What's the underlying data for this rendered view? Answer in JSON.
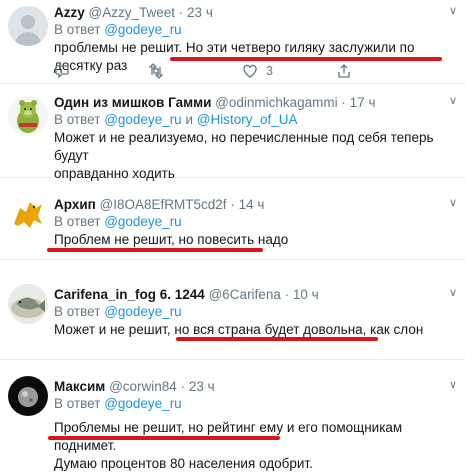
{
  "tweets": [
    {
      "name": "Azzy",
      "handle": "@Azzy_Tweet",
      "dot": "·",
      "time": "23 ч",
      "reply_prefix": "В ответ",
      "reply_to": "@godeye_ru",
      "reply_to_2": "",
      "text_lines": [
        "проблемы не решит. Но эти четверо гиляку заслужили по десятку раз"
      ],
      "likes": "3",
      "avatar": "gray-placeholder"
    },
    {
      "name": "Один из мишков Гамми",
      "handle": "@odinmichkagammi",
      "dot": "·",
      "time": "17 ч",
      "reply_prefix": "В ответ",
      "reply_to": "@godeye_ru",
      "reply_and": "и",
      "reply_to_2": "@History_of_UA",
      "text_lines": [
        "Может и не реализуемо, но перечисленные под себя теперь будут",
        "оправданно ходить"
      ],
      "likes": "",
      "avatar": "gummi-bear-green"
    },
    {
      "name": "Архип",
      "handle": "@I8OA8EfRMT5cd2f",
      "dot": "·",
      "time": "14 ч",
      "reply_prefix": "В ответ",
      "reply_to": "@godeye_ru",
      "text_lines": [
        "Проблем не решит, но повесить надо"
      ],
      "likes": "",
      "avatar": "griffin-yellow"
    },
    {
      "name": "Carifena_in_fog 6. 1244",
      "handle": "@6Carifena",
      "dot": "·",
      "time": "10 ч",
      "reply_prefix": "В ответ",
      "reply_to": "@godeye_ru",
      "text_lines": [
        "Может и не решит, но вся страна будет довольна, как слон"
      ],
      "likes": "",
      "avatar": "fish-on-plate"
    },
    {
      "name": "Максим",
      "handle": "@corwin84",
      "dot": "·",
      "time": "23 ч",
      "reply_prefix": "В ответ",
      "reply_to": "@godeye_ru",
      "text_lines": [
        "Проблемы не решит, но рейтинг ему и его помощникам поднимет.",
        "Думаю процентов 80 населения одобрит."
      ],
      "likes": "",
      "avatar": "dark-planet"
    }
  ],
  "icons": [
    "reply-icon",
    "retweet-icon",
    "like-icon",
    "share-icon",
    "chevron-down-icon"
  ],
  "colors": {
    "link": "#1b95e0",
    "muted": "#657786",
    "highlight_underline": "#d8141c",
    "border": "#e6ecf0"
  }
}
